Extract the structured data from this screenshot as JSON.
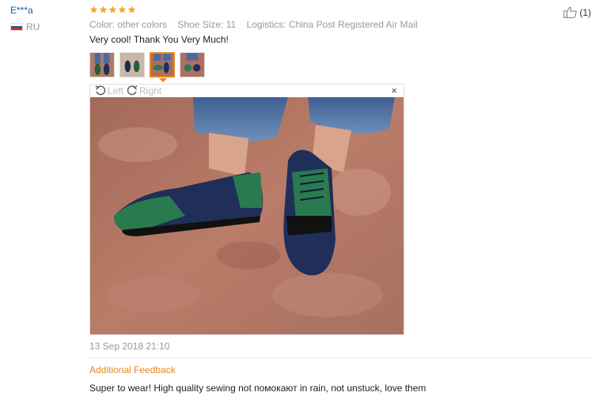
{
  "user": {
    "name": "E***a",
    "country": "RU"
  },
  "rating": {
    "stars": 5
  },
  "attributes": {
    "color": "Color: other colors",
    "shoe_size": "Shoe Size: 11",
    "logistics": "Logistics: China Post Registered Air Mail"
  },
  "review": {
    "text": "Very cool! Thank You Very Much!"
  },
  "helpful": {
    "count": "(1)"
  },
  "viewer": {
    "left_label": "Left",
    "right_label": "Right",
    "close": "×"
  },
  "date": "13 Sep 2018 21:10",
  "additional": {
    "label": "Additional Feedback",
    "text": "Super to wear! High quality sewing not помокают in rain, not unstuck, love them"
  },
  "colors": {
    "accent": "#e8871e",
    "link": "#1a5ba6",
    "star": "#f5a623"
  }
}
